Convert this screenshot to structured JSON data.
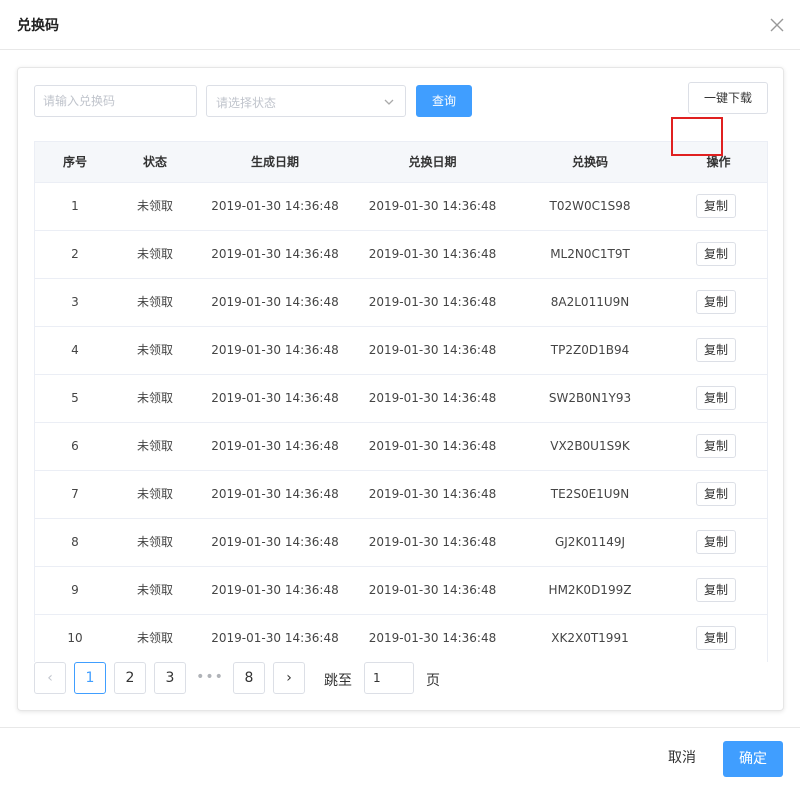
{
  "dialog": {
    "title": "兑换码"
  },
  "filters": {
    "code_placeholder": "请输入兑换码",
    "status_placeholder": "请选择状态",
    "query_label": "查询",
    "download_label": "一键下载"
  },
  "table": {
    "headers": [
      "序号",
      "状态",
      "生成日期",
      "兑换日期",
      "兑换码",
      "操作"
    ],
    "copy_label": "复制",
    "rows": [
      {
        "index": "1",
        "status": "未领取",
        "created": "2019-01-30 14:36:48",
        "redeemed": "2019-01-30 14:36:48",
        "code": "T02W0C1S98"
      },
      {
        "index": "2",
        "status": "未领取",
        "created": "2019-01-30 14:36:48",
        "redeemed": "2019-01-30 14:36:48",
        "code": "ML2N0C1T9T"
      },
      {
        "index": "3",
        "status": "未领取",
        "created": "2019-01-30 14:36:48",
        "redeemed": "2019-01-30 14:36:48",
        "code": "8A2L011U9N"
      },
      {
        "index": "4",
        "status": "未领取",
        "created": "2019-01-30 14:36:48",
        "redeemed": "2019-01-30 14:36:48",
        "code": "TP2Z0D1B94"
      },
      {
        "index": "5",
        "status": "未领取",
        "created": "2019-01-30 14:36:48",
        "redeemed": "2019-01-30 14:36:48",
        "code": "SW2B0N1Y93"
      },
      {
        "index": "6",
        "status": "未领取",
        "created": "2019-01-30 14:36:48",
        "redeemed": "2019-01-30 14:36:48",
        "code": "VX2B0U1S9K"
      },
      {
        "index": "7",
        "status": "未领取",
        "created": "2019-01-30 14:36:48",
        "redeemed": "2019-01-30 14:36:48",
        "code": "TE2S0E1U9N"
      },
      {
        "index": "8",
        "status": "未领取",
        "created": "2019-01-30 14:36:48",
        "redeemed": "2019-01-30 14:36:48",
        "code": "GJ2K01149J"
      },
      {
        "index": "9",
        "status": "未领取",
        "created": "2019-01-30 14:36:48",
        "redeemed": "2019-01-30 14:36:48",
        "code": "HM2K0D199Z"
      },
      {
        "index": "10",
        "status": "未领取",
        "created": "2019-01-30 14:36:48",
        "redeemed": "2019-01-30 14:36:48",
        "code": "XK2X0T1991"
      }
    ]
  },
  "pagination": {
    "prev_symbol": "‹",
    "next_symbol": "›",
    "pages": [
      "1",
      "2",
      "3"
    ],
    "ellipsis": "•••",
    "last_page": "8",
    "current_page": "1",
    "jump_label": "跳至",
    "jump_value": "1",
    "page_suffix": "页"
  },
  "footer": {
    "cancel_label": "取消",
    "ok_label": "确定"
  },
  "colors": {
    "primary": "#409eff",
    "highlight": "#e02020",
    "border": "#dcdfe6"
  }
}
